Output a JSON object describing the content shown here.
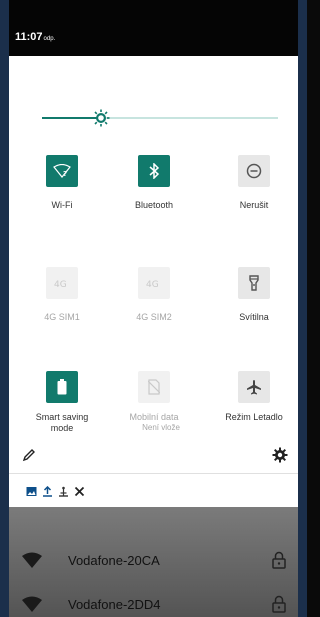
{
  "statusbar": {
    "time": "11:07",
    "ampm": "odp."
  },
  "brightness": {
    "level": 0.25
  },
  "tiles": [
    {
      "label": "Wi-Fi",
      "sub": "",
      "icon": "wifi-question-icon",
      "state": "on"
    },
    {
      "label": "Bluetooth",
      "sub": "",
      "icon": "bluetooth-icon",
      "state": "on"
    },
    {
      "label": "Nerušit",
      "sub": "",
      "icon": "do-not-disturb-icon",
      "state": "off"
    },
    {
      "label": "4G SIM1",
      "sub": "",
      "icon": "4g-icon",
      "state": "disabled"
    },
    {
      "label": "4G SIM2",
      "sub": "",
      "icon": "4g-icon",
      "state": "disabled"
    },
    {
      "label": "Svítilna",
      "sub": "",
      "icon": "flashlight-icon",
      "state": "off"
    },
    {
      "label": "Smart saving mode",
      "sub": "",
      "icon": "battery-icon",
      "state": "on"
    },
    {
      "label": "Mobilní data",
      "sub": "Není vlože",
      "icon": "no-sim-icon",
      "state": "disabled"
    },
    {
      "label": "Režim Letadlo",
      "sub": "",
      "icon": "airplane-icon",
      "state": "off"
    }
  ],
  "notification_icons": [
    "image-icon",
    "upload-icon",
    "usb-icon",
    "tools-icon"
  ],
  "wifi_networks": [
    {
      "name": "Vodafone-20CA",
      "secured": true
    },
    {
      "name": "Vodafone-2DD4",
      "secured": true
    }
  ],
  "colors": {
    "accent": "#117a6c",
    "disabled": "#a6a6a6"
  }
}
